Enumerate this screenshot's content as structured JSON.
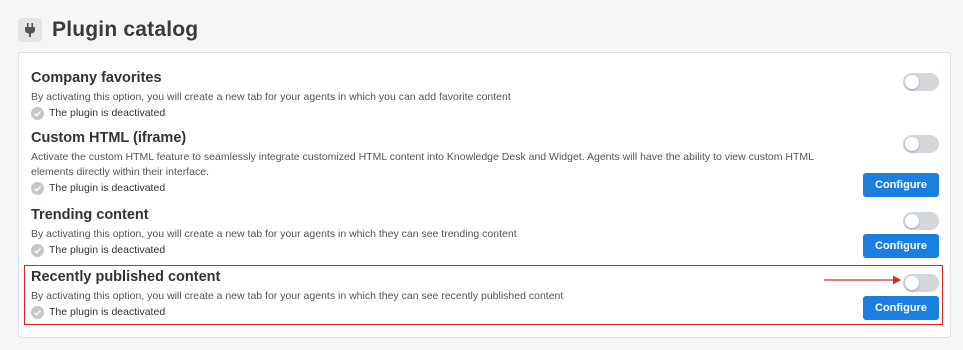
{
  "header": {
    "title": "Plugin catalog",
    "icon": "plug-icon"
  },
  "plugins": [
    {
      "name": "Company favorites",
      "description": "By activating this option, you will create a new tab for your agents in which you can add favorite content",
      "status": "The plugin is deactivated",
      "enabled": false
    },
    {
      "name": "Custom HTML (iframe)",
      "description": "Activate the custom HTML feature to seamlessly integrate customized HTML content into Knowledge Desk and Widget. Agents will have the ability to view custom HTML elements directly within their interface.",
      "status": "The plugin is deactivated",
      "enabled": false,
      "configure_label": "Configure"
    },
    {
      "name": "Trending content",
      "description": "By activating this option, you will create a new tab for your agents in which they can see trending content",
      "status": "The plugin is deactivated",
      "enabled": false,
      "configure_label": "Configure"
    },
    {
      "name": "Recently published content",
      "description": "By activating this option, you will create a new tab for your agents in which they can see recently published content",
      "status": "The plugin is deactivated",
      "enabled": false,
      "configure_label": "Configure",
      "highlighted": true
    }
  ],
  "colors": {
    "accent": "#1a7fe0",
    "highlight": "#e02424",
    "toggle_off": "#d3d6da"
  }
}
